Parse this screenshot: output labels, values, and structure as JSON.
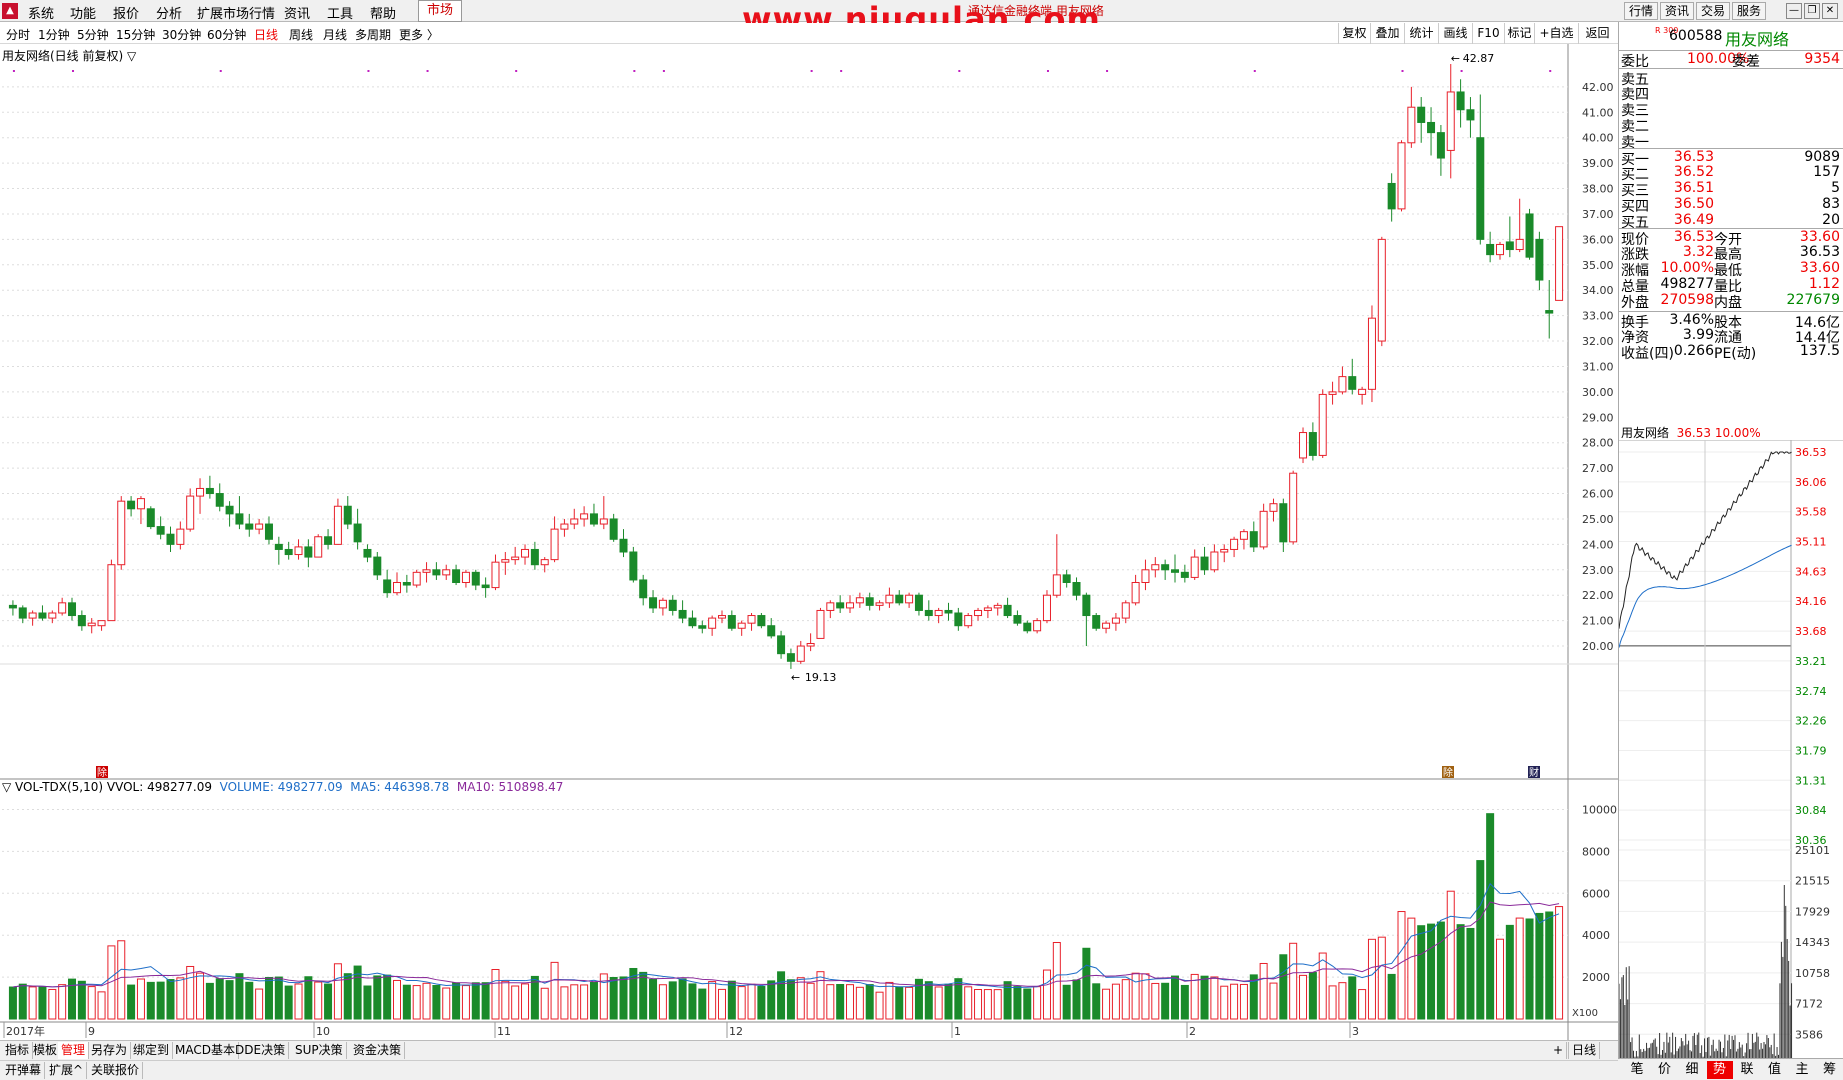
{
  "menubar": {
    "items": [
      "系统",
      "功能",
      "报价",
      "分析",
      "扩展市场行情",
      "资讯",
      "工具",
      "帮助"
    ],
    "market": "市场",
    "watermark": "www.niugulan.com",
    "watermark_sub": "通达信金融终端 用友网络",
    "right_buttons": [
      "行情",
      "资讯",
      "交易",
      "服务"
    ]
  },
  "periods": [
    "分时",
    "1分钟",
    "5分钟",
    "15分钟",
    "30分钟",
    "60分钟",
    "日线",
    "周线",
    "月线",
    "多周期",
    "更多 〉"
  ],
  "active_period": "日线",
  "toolbar": [
    "复权",
    "叠加",
    "统计",
    "画线",
    "F10",
    "标记",
    "+自选",
    "返回"
  ],
  "chart": {
    "title": "用友网络(日线 前复权) ▽",
    "high_label": "42.87",
    "low_label": "19.13",
    "y_ticks": [
      "42.00",
      "41.00",
      "40.00",
      "39.00",
      "38.00",
      "37.00",
      "36.00",
      "35.00",
      "34.00",
      "33.00",
      "32.00",
      "31.00",
      "30.00",
      "29.00",
      "28.00",
      "27.00",
      "26.00",
      "25.00",
      "24.00",
      "23.00",
      "22.00",
      "21.00",
      "20.00"
    ],
    "badges": [
      "除",
      "除",
      "财"
    ]
  },
  "volume": {
    "header": "▽ VOL-TDX(5,10)  VVOL: 498277.09",
    "volume": "VOLUME: 498277.09",
    "ma5": "MA5: 446398.78",
    "ma10": "MA10: 510898.47",
    "y_ticks": [
      "10000",
      "8000",
      "6000",
      "4000",
      "2000"
    ],
    "x100": "X100",
    "period": "日线"
  },
  "xaxis": {
    "labels": [
      "2017年",
      "9",
      "10",
      "11",
      "12",
      "1",
      "2",
      "3"
    ]
  },
  "chart_data": {
    "type": "candlestick",
    "symbol": "600588",
    "name": "用友网络",
    "candles": [
      [
        21.6,
        21.8,
        21.2,
        21.5
      ],
      [
        21.5,
        21.6,
        20.9,
        21.1
      ],
      [
        21.1,
        21.4,
        20.8,
        21.3
      ],
      [
        21.3,
        21.6,
        21.0,
        21.1
      ],
      [
        21.1,
        21.4,
        20.9,
        21.3
      ],
      [
        21.3,
        21.9,
        21.2,
        21.7
      ],
      [
        21.7,
        21.9,
        21.0,
        21.2
      ],
      [
        21.2,
        21.4,
        20.6,
        20.8
      ],
      [
        20.8,
        21.1,
        20.5,
        20.9
      ],
      [
        20.8,
        21.0,
        20.6,
        21.0
      ],
      [
        21.0,
        23.4,
        21.0,
        23.2
      ],
      [
        23.2,
        25.9,
        23.0,
        25.7
      ],
      [
        25.7,
        25.9,
        25.1,
        25.4
      ],
      [
        25.4,
        25.9,
        24.8,
        25.8
      ],
      [
        25.4,
        25.5,
        24.6,
        24.7
      ],
      [
        24.7,
        25.1,
        24.2,
        24.4
      ],
      [
        24.4,
        24.7,
        23.7,
        24.0
      ],
      [
        24.0,
        24.9,
        23.8,
        24.6
      ],
      [
        24.6,
        26.2,
        24.5,
        25.9
      ],
      [
        25.9,
        26.6,
        25.2,
        26.2
      ],
      [
        26.2,
        26.7,
        25.8,
        26.0
      ],
      [
        26.0,
        26.4,
        25.3,
        25.5
      ],
      [
        25.5,
        25.7,
        24.7,
        25.2
      ],
      [
        25.2,
        25.9,
        24.6,
        24.8
      ],
      [
        24.8,
        25.2,
        24.3,
        24.6
      ],
      [
        24.6,
        25.0,
        24.4,
        24.8
      ],
      [
        24.8,
        25.1,
        24.0,
        24.2
      ],
      [
        24.0,
        24.3,
        23.2,
        23.8
      ],
      [
        23.8,
        24.1,
        23.4,
        23.6
      ],
      [
        23.6,
        24.2,
        23.4,
        23.9
      ],
      [
        23.9,
        24.2,
        23.1,
        23.5
      ],
      [
        23.5,
        24.4,
        23.5,
        24.3
      ],
      [
        24.3,
        24.6,
        23.8,
        24.0
      ],
      [
        24.0,
        25.8,
        24.0,
        25.5
      ],
      [
        25.5,
        25.9,
        24.6,
        24.8
      ],
      [
        24.8,
        25.4,
        23.8,
        24.1
      ],
      [
        23.8,
        24.0,
        23.3,
        23.5
      ],
      [
        23.5,
        23.7,
        22.6,
        22.8
      ],
      [
        22.6,
        23.0,
        21.9,
        22.1
      ],
      [
        22.1,
        22.9,
        22.0,
        22.5
      ],
      [
        22.5,
        22.8,
        22.1,
        22.4
      ],
      [
        22.4,
        23.0,
        22.3,
        22.9
      ],
      [
        22.9,
        23.3,
        22.5,
        23.0
      ],
      [
        23.0,
        23.3,
        22.6,
        22.8
      ],
      [
        22.8,
        23.2,
        22.6,
        23.0
      ],
      [
        23.0,
        23.2,
        22.4,
        22.5
      ],
      [
        22.5,
        23.0,
        22.3,
        22.9
      ],
      [
        22.9,
        23.0,
        22.2,
        22.4
      ],
      [
        22.4,
        22.7,
        21.9,
        22.3
      ],
      [
        22.3,
        23.6,
        22.2,
        23.3
      ],
      [
        23.3,
        23.7,
        22.8,
        23.4
      ],
      [
        23.4,
        23.9,
        23.2,
        23.5
      ],
      [
        23.5,
        24.0,
        23.2,
        23.8
      ],
      [
        23.8,
        24.1,
        23.0,
        23.2
      ],
      [
        23.2,
        23.5,
        22.9,
        23.4
      ],
      [
        23.4,
        25.1,
        23.3,
        24.6
      ],
      [
        24.6,
        25.0,
        24.3,
        24.8
      ],
      [
        24.8,
        25.4,
        24.6,
        25.0
      ],
      [
        25.0,
        25.5,
        24.7,
        25.2
      ],
      [
        25.2,
        25.6,
        24.7,
        24.8
      ],
      [
        24.8,
        25.9,
        24.6,
        25.0
      ],
      [
        25.0,
        25.2,
        24.1,
        24.2
      ],
      [
        24.2,
        24.6,
        23.5,
        23.7
      ],
      [
        23.7,
        23.9,
        22.5,
        22.6
      ],
      [
        22.6,
        22.8,
        21.6,
        21.9
      ],
      [
        21.9,
        22.2,
        21.3,
        21.5
      ],
      [
        21.5,
        21.9,
        21.2,
        21.8
      ],
      [
        21.8,
        22.0,
        21.2,
        21.4
      ],
      [
        21.4,
        21.8,
        20.9,
        21.1
      ],
      [
        21.1,
        21.4,
        20.7,
        20.8
      ],
      [
        20.8,
        21.0,
        20.5,
        20.7
      ],
      [
        20.7,
        21.2,
        20.4,
        21.1
      ],
      [
        21.1,
        21.4,
        20.9,
        21.2
      ],
      [
        21.2,
        21.4,
        20.6,
        20.7
      ],
      [
        20.7,
        21.0,
        20.4,
        20.9
      ],
      [
        20.9,
        21.3,
        20.6,
        21.2
      ],
      [
        21.2,
        21.3,
        20.7,
        20.8
      ],
      [
        20.8,
        21.1,
        20.3,
        20.4
      ],
      [
        20.4,
        20.6,
        19.5,
        19.7
      ],
      [
        19.7,
        19.9,
        19.1,
        19.4
      ],
      [
        19.4,
        20.2,
        19.3,
        20.0
      ],
      [
        20.0,
        20.5,
        19.8,
        20.1
      ],
      [
        20.3,
        21.5,
        20.3,
        21.4
      ],
      [
        21.4,
        21.8,
        21.1,
        21.7
      ],
      [
        21.7,
        22.0,
        21.3,
        21.5
      ],
      [
        21.5,
        22.0,
        21.3,
        21.7
      ],
      [
        21.7,
        22.1,
        21.5,
        21.9
      ],
      [
        21.9,
        22.1,
        21.4,
        21.6
      ],
      [
        21.6,
        21.8,
        21.4,
        21.7
      ],
      [
        21.7,
        22.3,
        21.5,
        22.0
      ],
      [
        22.0,
        22.2,
        21.6,
        21.7
      ],
      [
        21.7,
        22.1,
        21.5,
        22.0
      ],
      [
        22.0,
        22.1,
        21.2,
        21.4
      ],
      [
        21.4,
        21.8,
        21.0,
        21.2
      ],
      [
        21.2,
        21.5,
        20.9,
        21.4
      ],
      [
        21.4,
        21.7,
        21.0,
        21.3
      ],
      [
        21.3,
        21.5,
        20.6,
        20.8
      ],
      [
        20.8,
        21.3,
        20.7,
        21.2
      ],
      [
        21.2,
        21.5,
        21.0,
        21.4
      ],
      [
        21.4,
        21.6,
        21.1,
        21.5
      ],
      [
        21.5,
        21.7,
        21.2,
        21.6
      ],
      [
        21.6,
        21.9,
        21.1,
        21.2
      ],
      [
        21.2,
        21.4,
        20.8,
        20.9
      ],
      [
        20.9,
        21.0,
        20.5,
        20.6
      ],
      [
        20.6,
        21.1,
        20.5,
        21.0
      ],
      [
        21.0,
        22.2,
        20.9,
        22.0
      ],
      [
        22.0,
        24.4,
        21.9,
        22.8
      ],
      [
        22.8,
        23.0,
        22.3,
        22.5
      ],
      [
        22.5,
        22.7,
        21.8,
        22.0
      ],
      [
        22.0,
        22.1,
        20.0,
        21.2
      ],
      [
        21.2,
        21.3,
        20.6,
        20.7
      ],
      [
        20.7,
        21.0,
        20.5,
        20.9
      ],
      [
        20.9,
        21.3,
        20.6,
        21.1
      ],
      [
        21.1,
        21.8,
        20.9,
        21.7
      ],
      [
        21.7,
        22.8,
        21.6,
        22.5
      ],
      [
        22.5,
        23.4,
        22.2,
        23.0
      ],
      [
        23.0,
        23.5,
        22.7,
        23.2
      ],
      [
        23.2,
        23.4,
        22.6,
        23.0
      ],
      [
        23.0,
        23.6,
        22.5,
        22.9
      ],
      [
        22.9,
        23.2,
        22.5,
        22.7
      ],
      [
        22.7,
        23.8,
        22.6,
        23.5
      ],
      [
        23.5,
        23.9,
        22.8,
        23.0
      ],
      [
        23.0,
        24.0,
        22.9,
        23.7
      ],
      [
        23.7,
        24.0,
        23.3,
        23.8
      ],
      [
        23.8,
        24.3,
        23.5,
        24.2
      ],
      [
        24.2,
        24.6,
        23.8,
        24.5
      ],
      [
        24.5,
        24.9,
        23.7,
        23.9
      ],
      [
        23.9,
        25.6,
        23.8,
        25.3
      ],
      [
        25.3,
        25.8,
        24.9,
        25.6
      ],
      [
        25.6,
        25.8,
        23.7,
        24.1
      ],
      [
        24.1,
        26.9,
        24.0,
        26.8
      ],
      [
        27.4,
        28.6,
        27.2,
        28.4
      ],
      [
        28.4,
        28.8,
        27.3,
        27.5
      ],
      [
        27.5,
        30.1,
        27.4,
        29.9
      ],
      [
        29.9,
        30.4,
        29.5,
        30.0
      ],
      [
        30.0,
        31.0,
        29.9,
        30.6
      ],
      [
        30.6,
        31.3,
        29.9,
        30.1
      ],
      [
        29.9,
        30.2,
        29.5,
        30.1
      ],
      [
        30.1,
        33.4,
        29.6,
        32.9
      ],
      [
        32.0,
        36.1,
        31.8,
        36.0
      ],
      [
        38.2,
        38.6,
        36.7,
        37.2
      ],
      [
        37.2,
        39.9,
        37.1,
        39.8
      ],
      [
        39.8,
        42.0,
        39.6,
        41.2
      ],
      [
        41.2,
        41.6,
        39.8,
        40.6
      ],
      [
        40.6,
        41.2,
        39.3,
        40.2
      ],
      [
        40.2,
        40.5,
        38.5,
        39.2
      ],
      [
        39.5,
        42.9,
        38.4,
        41.8
      ],
      [
        41.8,
        42.3,
        40.4,
        41.1
      ],
      [
        41.1,
        41.6,
        40.0,
        40.7
      ],
      [
        40.0,
        41.7,
        35.8,
        36.0
      ],
      [
        35.8,
        36.3,
        35.1,
        35.4
      ],
      [
        35.4,
        35.9,
        35.2,
        35.8
      ],
      [
        35.9,
        36.9,
        35.3,
        35.6
      ],
      [
        35.6,
        37.6,
        35.5,
        36.0
      ],
      [
        37.0,
        37.2,
        35.2,
        35.3
      ],
      [
        36.0,
        36.3,
        34.0,
        34.4
      ],
      [
        33.2,
        34.4,
        32.1,
        33.1
      ],
      [
        33.6,
        36.5,
        33.6,
        36.5
      ]
    ]
  },
  "quote": {
    "code": "600588",
    "name": "用友网络",
    "badge": "R 300",
    "wei": [
      [
        "委比",
        "100.00%"
      ],
      [
        "委差",
        "9354"
      ]
    ],
    "sell": [
      "卖五",
      "卖四",
      "卖三",
      "卖二",
      "卖一"
    ],
    "buy": [
      [
        "买一",
        "36.53",
        "9089"
      ],
      [
        "买二",
        "36.52",
        "157"
      ],
      [
        "买三",
        "36.51",
        "5"
      ],
      [
        "买四",
        "36.50",
        "83"
      ],
      [
        "买五",
        "36.49",
        "20"
      ]
    ],
    "stats": [
      [
        "现价",
        "36.53",
        "今开",
        "33.60"
      ],
      [
        "涨跌",
        "3.32",
        "最高",
        "36.53"
      ],
      [
        "涨幅",
        "10.00%",
        "最低",
        "33.60"
      ],
      [
        "总量",
        "498277",
        "量比",
        "1.12"
      ],
      [
        "外盘",
        "270598",
        "内盘",
        "227679"
      ],
      [
        "换手",
        "3.46%",
        "股本",
        "14.6亿"
      ],
      [
        "净资",
        "3.99",
        "流通",
        "14.4亿"
      ],
      [
        "收益(四)",
        "0.266",
        "PE(动)",
        "137.5"
      ]
    ],
    "mini_title": "用友网络",
    "mini_price": "36.53",
    "mini_pct": "10.00%",
    "mini_ticks": [
      "36.53",
      "36.06",
      "35.58",
      "35.11",
      "34.63",
      "34.16",
      "33.68",
      "33.21",
      "32.74",
      "32.26",
      "31.79",
      "31.31",
      "30.84",
      "30.36"
    ],
    "mini_vol_ticks": [
      "25101",
      "21515",
      "17929",
      "14343",
      "10758",
      "7172",
      "3586"
    ]
  },
  "bottom_tabs": [
    "指标",
    "模板",
    "管理",
    "另存为",
    "绑定到",
    "MACD基本",
    "DDE决策",
    "SUP决策",
    "资金决策"
  ],
  "bottom_tabs2": [
    "开弹幕",
    "扩展^",
    "关联报价"
  ],
  "right_tabs": [
    "笔",
    "价",
    "细",
    "势",
    "联",
    "值",
    "主",
    "筹"
  ],
  "active_right_tab": "势",
  "colors": {
    "up": "#e8202a",
    "down": "#1a8a2a",
    "ma5": "#1e6ec8",
    "ma10": "#8a2a9a"
  }
}
